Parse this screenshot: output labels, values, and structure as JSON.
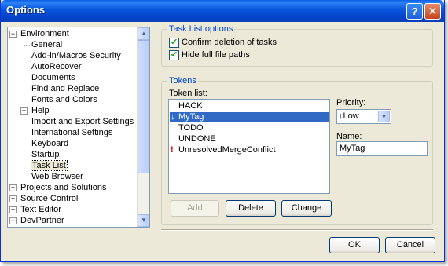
{
  "window": {
    "title": "Options",
    "help_glyph": "?",
    "close_glyph": "✕"
  },
  "tree": {
    "items": [
      {
        "label": "Environment",
        "expander": "−",
        "level": 0
      },
      {
        "label": "General",
        "level": 1
      },
      {
        "label": "Add-in/Macros Security",
        "level": 1
      },
      {
        "label": "AutoRecover",
        "level": 1
      },
      {
        "label": "Documents",
        "level": 1
      },
      {
        "label": "Find and Replace",
        "level": 1
      },
      {
        "label": "Fonts and Colors",
        "level": 1
      },
      {
        "label": "Help",
        "expander": "+",
        "level": 1
      },
      {
        "label": "Import and Export Settings",
        "level": 1
      },
      {
        "label": "International Settings",
        "level": 1
      },
      {
        "label": "Keyboard",
        "level": 1
      },
      {
        "label": "Startup",
        "level": 1
      },
      {
        "label": "Task List",
        "level": 1,
        "selected": true
      },
      {
        "label": "Web Browser",
        "level": 1
      },
      {
        "label": "Projects and Solutions",
        "expander": "+",
        "level": 0
      },
      {
        "label": "Source Control",
        "expander": "+",
        "level": 0
      },
      {
        "label": "Text Editor",
        "expander": "+",
        "level": 0
      },
      {
        "label": "DevPartner",
        "expander": "+",
        "level": 0
      }
    ],
    "scroll_up": "▲",
    "scroll_down": "▼"
  },
  "task_list_options": {
    "title": "Task List options",
    "confirm_deletion": {
      "label": "Confirm deletion of tasks",
      "checked": true,
      "mark": "✔"
    },
    "hide_paths": {
      "label": "Hide full file paths",
      "checked": true,
      "mark": "✔"
    }
  },
  "tokens": {
    "title": "Tokens",
    "list_label": "Token list:",
    "items": [
      {
        "label": "HACK",
        "icon": ""
      },
      {
        "label": "MyTag",
        "icon": "↓",
        "selected": true
      },
      {
        "label": "TODO",
        "icon": ""
      },
      {
        "label": "UNDONE",
        "icon": ""
      },
      {
        "label": "UnresolvedMergeConflict",
        "icon": "!"
      }
    ],
    "priority_label": "Priority:",
    "priority_value": "↓Low",
    "combo_arrow": "▼",
    "name_label": "Name:",
    "name_value": "MyTag",
    "add_label": "Add",
    "delete_label": "Delete",
    "change_label": "Change"
  },
  "footer": {
    "ok_label": "OK",
    "cancel_label": "Cancel"
  },
  "colors": {
    "accent": "#0046d5",
    "selection": "#316ac5",
    "warning": "#e00000"
  }
}
